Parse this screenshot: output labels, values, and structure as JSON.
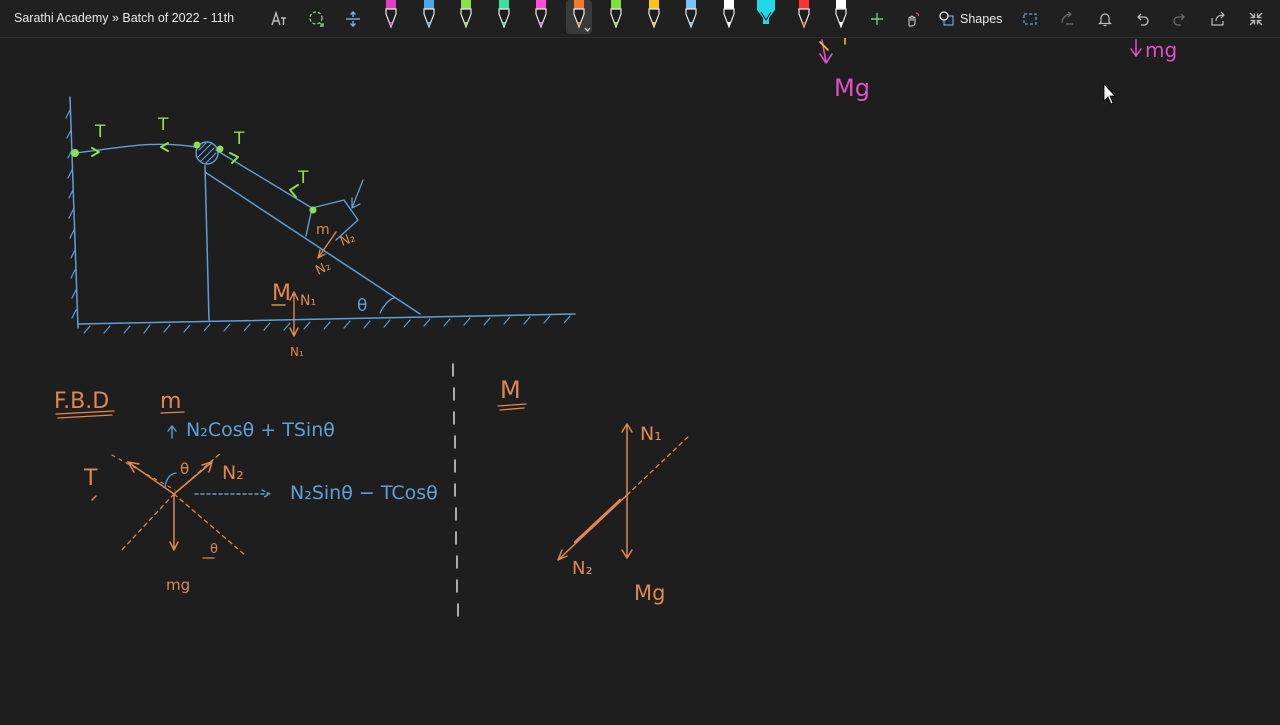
{
  "app": {
    "title": "Sarathi Academy » Batch of 2022 - 11th"
  },
  "toolbar": {
    "shapes_label": "Shapes",
    "pens": [
      {
        "color": "#e040c0"
      },
      {
        "color": "#4aa8e8"
      },
      {
        "color": "#8ee04a"
      },
      {
        "color": "#3ae0a0"
      },
      {
        "color": "#ff4fd8"
      },
      {
        "color": "#f07a30",
        "selected": true
      },
      {
        "color": "#7ee03a"
      },
      {
        "color": "#ffc21a"
      },
      {
        "color": "#7ac0ff"
      },
      {
        "color": "#ffffff"
      },
      {
        "color": "#20d8e8",
        "highlighter": true
      },
      {
        "color": "#ff3030"
      },
      {
        "color": "#ffffff"
      }
    ]
  },
  "whiteboard": {
    "labels": {
      "mg_top_left": "Mg",
      "mg_top_right": "mg",
      "tension_1": "T",
      "tension_2": "T",
      "tension_3": "T",
      "tension_4": "T",
      "block_m": "m",
      "n2_incline": "N₂",
      "n2_incline_2": "N₂",
      "wedge_M": "M",
      "n1_wedge": "N₁",
      "n1_below": "N₁",
      "theta_wedge": "θ",
      "fbd_title": "F.B.D",
      "fbd_m": "m",
      "fbd_vertical_eq": "N₂Cosθ + TSinθ",
      "fbd_horizontal_eq": "N₂Sinθ − TCosθ",
      "fbd_T": "T",
      "fbd_N2": "N₂",
      "fbd_theta": "θ",
      "fbd_theta_2": "θ",
      "fbd_mg": "mg",
      "fbd_M": "M",
      "fbd_M_N1": "N₁",
      "fbd_M_N2": "N₂",
      "fbd_M_Mg": "Mg"
    },
    "colors": {
      "blue_ink": "#5f9fd8",
      "green_ink": "#8ee04a",
      "orange_ink": "#e08850",
      "pink_ink": "#e050c8",
      "yellow_ink": "#ffc21a",
      "background": "#1e1e1e"
    }
  }
}
